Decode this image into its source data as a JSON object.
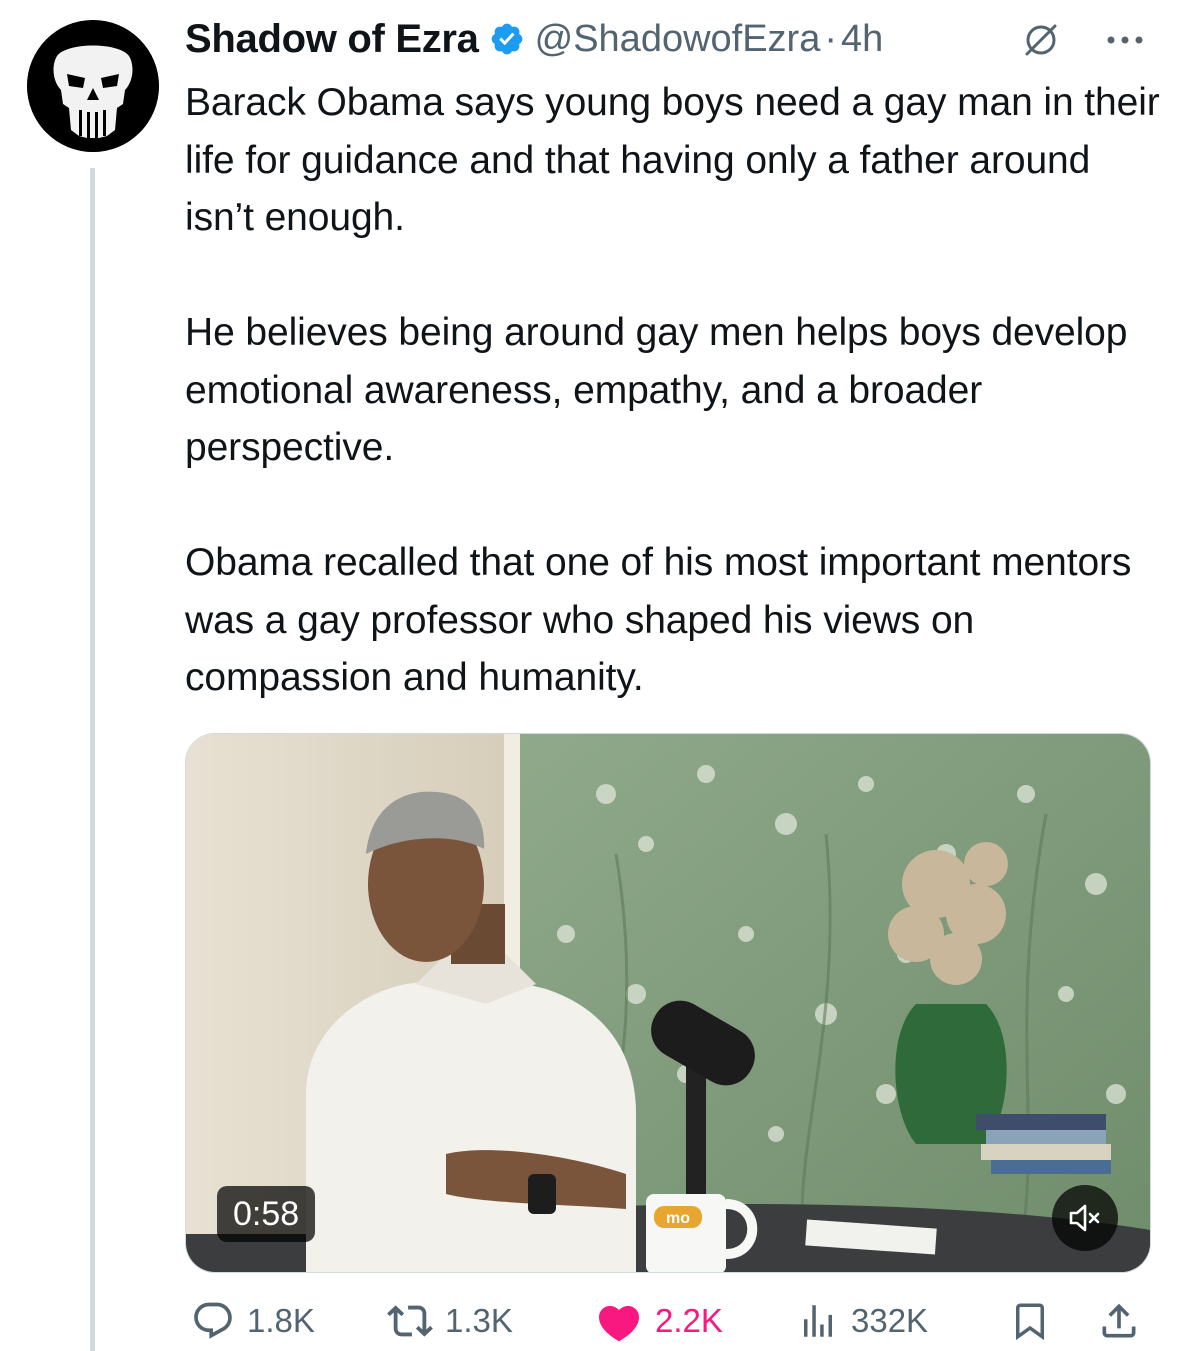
{
  "tweet": {
    "author_name": "Shadow of Ezra",
    "author_handle": "@ShadowofEzra",
    "separator": "·",
    "time": "4h",
    "paragraphs": [
      "Barack Obama says young boys need a gay man in their life for guidance and that having only a father around isn’t enough.",
      "He believes being around gay men helps boys develop emotional awareness, empathy, and a broader perspective.",
      "Obama recalled that one of his most important mentors was a gay professor who shaped his views on compassion and humanity."
    ],
    "video": {
      "duration": "0:58",
      "mug_text": "mo",
      "muted": true
    },
    "stats": {
      "replies": "1.8K",
      "reposts": "1.3K",
      "likes": "2.2K",
      "views": "332K"
    }
  },
  "icons": {
    "verified": "verified-badge-icon",
    "grok": "grok-icon",
    "more": "more-icon",
    "reply": "reply-icon",
    "repost": "repost-icon",
    "like": "heart-icon",
    "views": "views-chart-icon",
    "bookmark": "bookmark-icon",
    "share": "share-icon",
    "mute": "speaker-muted-icon"
  },
  "colors": {
    "verified_blue": "#1d9bf0",
    "like_pink": "#f91880",
    "secondary_text": "#536471",
    "thread_line": "#cfd9de"
  }
}
